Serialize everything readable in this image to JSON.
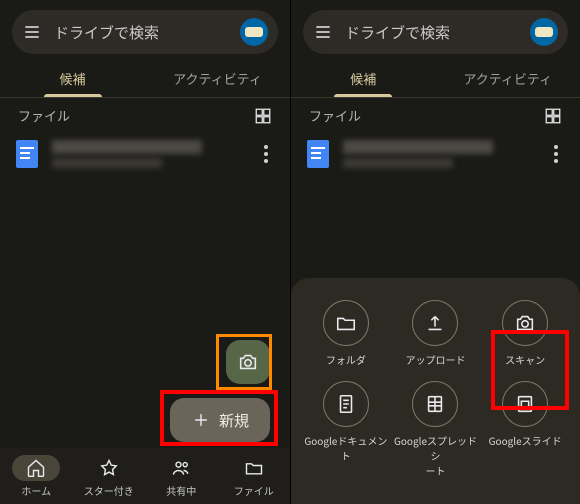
{
  "search": {
    "placeholder": "ドライブで検索"
  },
  "tabs": {
    "suggested": "候補",
    "activity": "アクティビティ"
  },
  "section": {
    "files": "ファイル"
  },
  "fab": {
    "new": "新規"
  },
  "nav": {
    "home": "ホーム",
    "starred": "スター付き",
    "shared": "共有中",
    "files": "ファイル"
  },
  "sheet": {
    "folder": "フォルダ",
    "upload": "アップロード",
    "scan": "スキャン",
    "docs": "Googleドキュメント",
    "sheets": "Googleスプレッドシ\nート",
    "slides": "Googleスライド"
  }
}
